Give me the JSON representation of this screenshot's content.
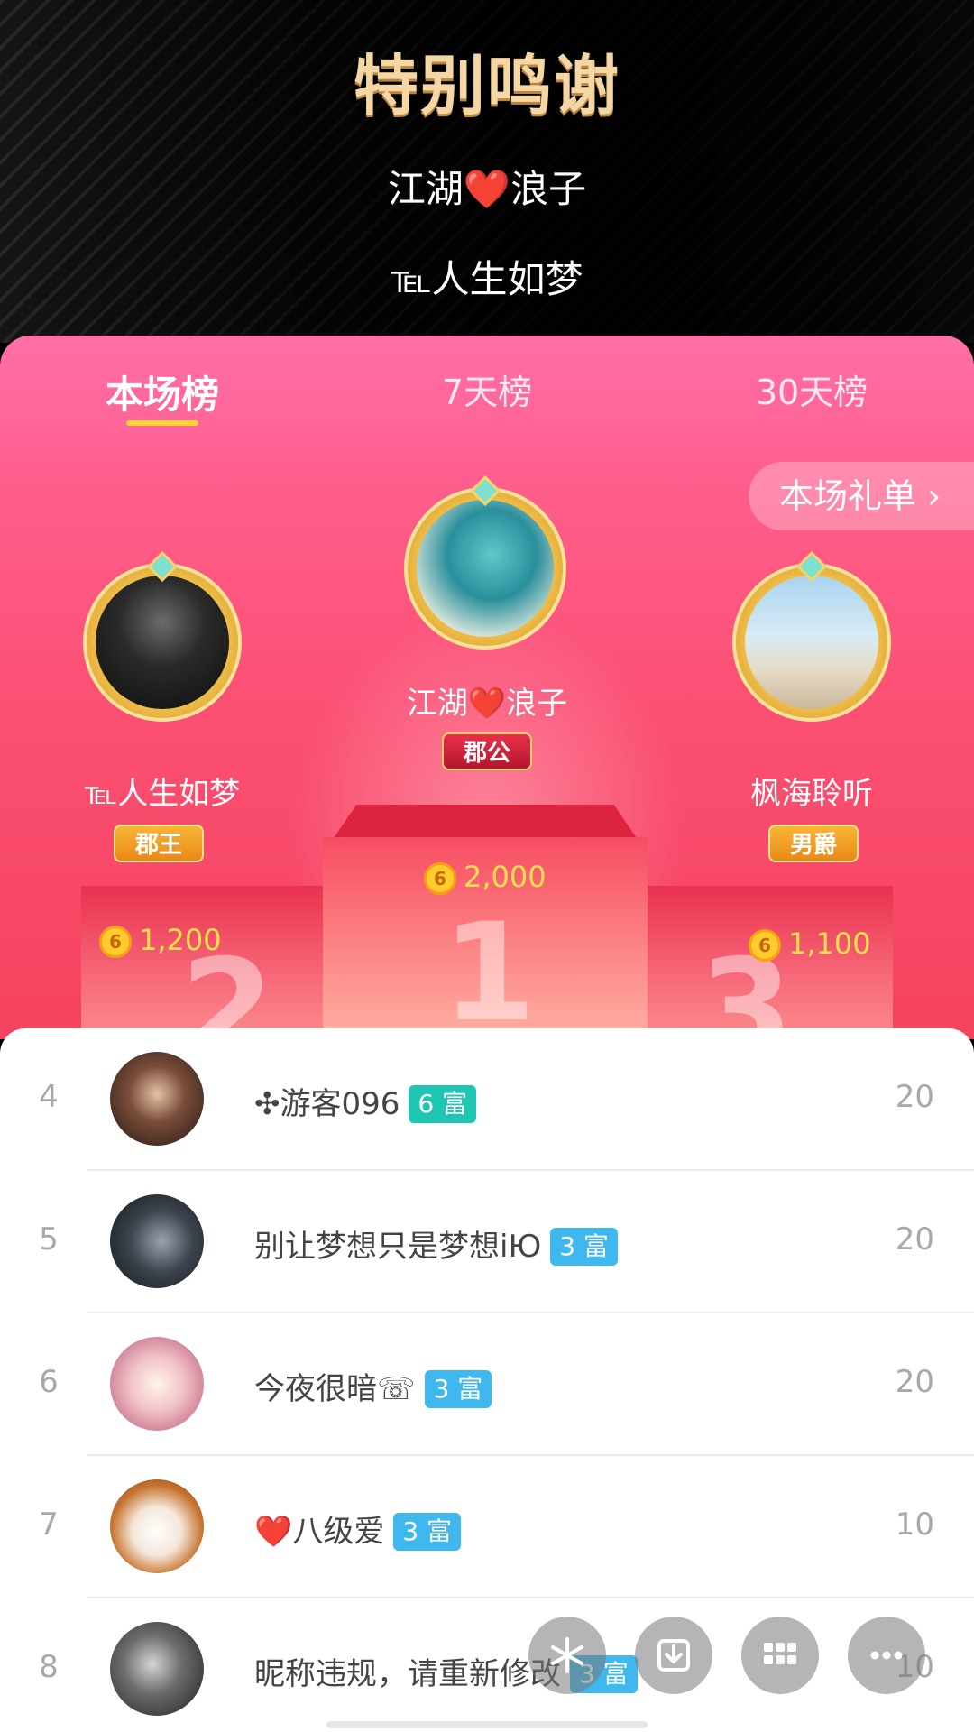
{
  "header": {
    "title": "特别鸣谢",
    "names": [
      "江湖❤️浪子",
      "℡人生如梦"
    ]
  },
  "tabs": [
    {
      "label": "本场榜",
      "active": true
    },
    {
      "label": "7天榜",
      "active": false
    },
    {
      "label": "30天榜",
      "active": false
    }
  ],
  "gift_list_button": "本场礼单 ›",
  "top3": [
    {
      "rank": "1",
      "name": "江湖❤️浪子",
      "title": "郡公",
      "coins": "2,000"
    },
    {
      "rank": "2",
      "name": "℡人生如梦",
      "title": "郡王",
      "coins": "1,200"
    },
    {
      "rank": "3",
      "name": "枫海聆听",
      "title": "男爵",
      "coins": "1,100"
    }
  ],
  "coin_glyph": "6",
  "list": [
    {
      "rank": "4",
      "name": "✣游客096",
      "level": "6 富",
      "score": "20"
    },
    {
      "rank": "5",
      "name": "别让梦想只是梦想iЮ",
      "level": "3 富",
      "score": "20"
    },
    {
      "rank": "6",
      "name": "今夜很暗☏",
      "level": "3 富",
      "score": "20"
    },
    {
      "rank": "7",
      "name": "❤️八级爱",
      "level": "3 富",
      "score": "10"
    },
    {
      "rank": "8",
      "name": "昵称违规，请重新修改",
      "level": "3 富",
      "score": "10"
    }
  ],
  "colors": {
    "accent_yellow": "#ffd23c",
    "panel_pink": "#fb4f72",
    "wealth_teal": "#1fc6b4",
    "wealth_blue": "#3fb8f0"
  },
  "fab_icons": [
    "asterisk-icon",
    "download-icon",
    "grid-icon",
    "more-icon"
  ]
}
